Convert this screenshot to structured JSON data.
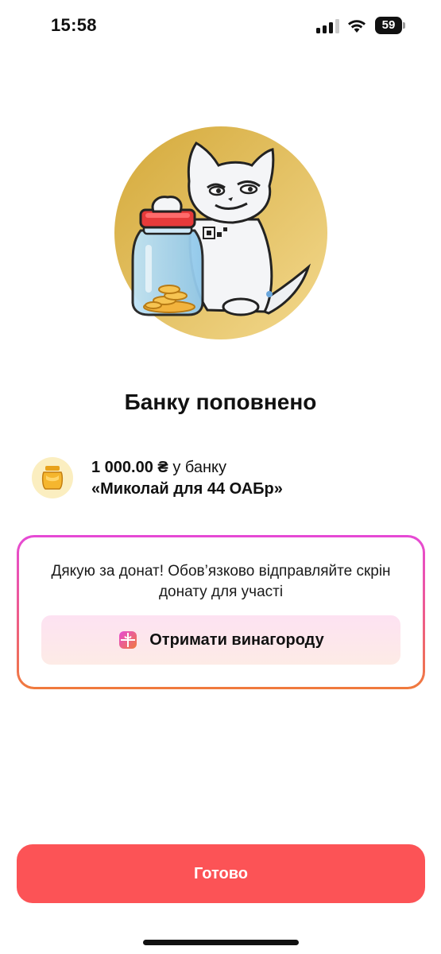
{
  "status_bar": {
    "time": "15:58",
    "battery_level": "59",
    "icons": [
      "signal-icon",
      "wifi-icon",
      "battery-icon"
    ]
  },
  "hero": {
    "icon": "cat-with-jar-illustration",
    "circle_color_from": "#d4a93a",
    "circle_color_to": "#f3d98e"
  },
  "title": "Банку поповнено",
  "info": {
    "icon": "honey-jar-icon",
    "amount": "1 000.00 ₴",
    "suffix": "у банку",
    "jar_name": "«Миколай для 44 ОАБр»"
  },
  "promo": {
    "message": "Дякую за донат! Обов’язково відправляйте скрін донату для участі",
    "button_label": "Отримати винагороду",
    "button_icon": "gift-icon"
  },
  "done_button_label": "Готово",
  "colors": {
    "accent_red": "#fc5356",
    "card_gradient_top": "#e64ad6",
    "card_gradient_bottom": "#f07a3c"
  }
}
